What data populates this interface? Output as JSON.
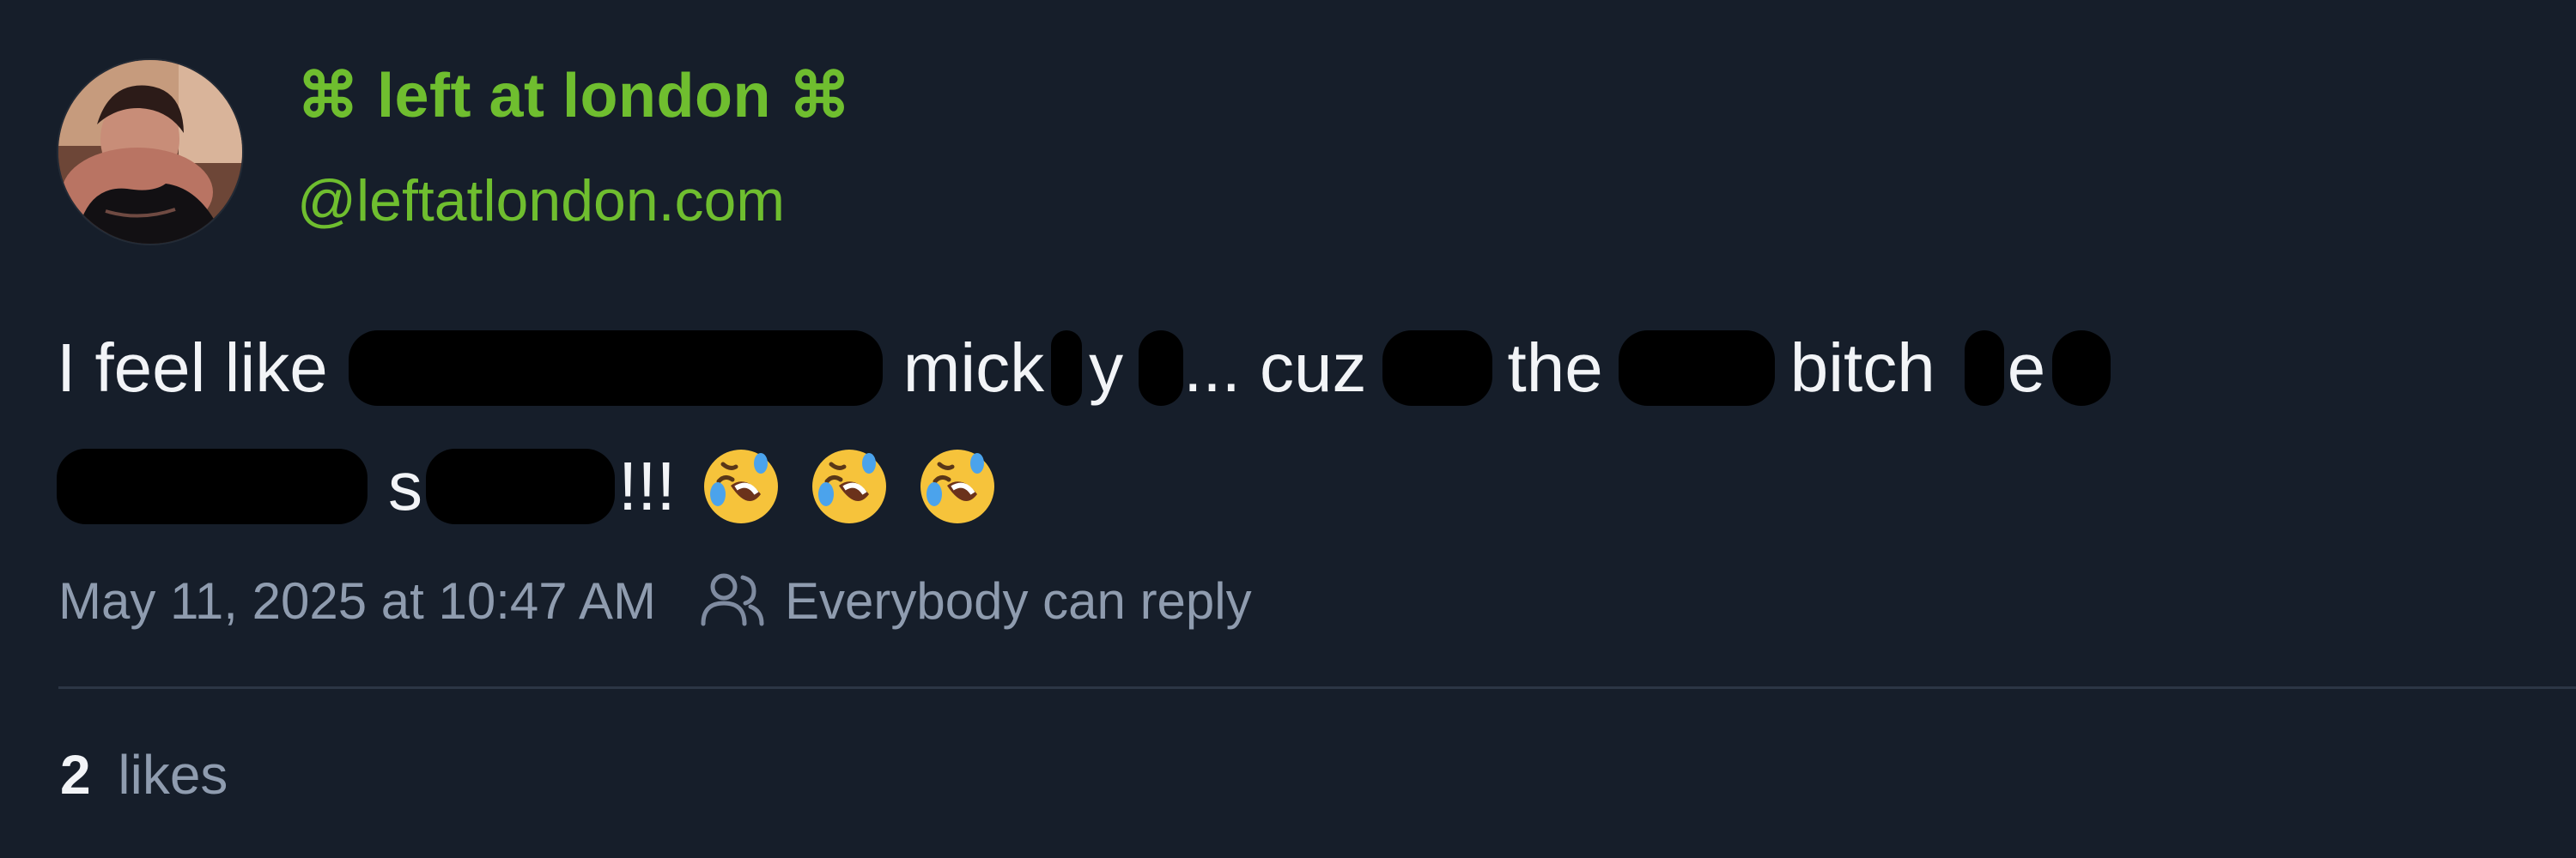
{
  "author": {
    "display_name": "⌘ left at london ⌘",
    "handle": "@leftatlondon.com",
    "accent_color": "#6fbe2f"
  },
  "post": {
    "line1": {
      "w1": "I feel like",
      "w2": "mick",
      "w3": "y",
      "w4": "... cuz",
      "w5": "the",
      "w6": "bitch",
      "w7": "e"
    },
    "line2": {
      "w1": "s",
      "w2": "!!!",
      "emoji_name": "rolling-on-floor-laughing-emoji"
    }
  },
  "meta": {
    "timestamp": "May 11, 2025 at 10:47 AM",
    "reply_setting": "Everybody can reply",
    "reply_icon": "people-icon"
  },
  "engagement": {
    "likes_count": "2",
    "likes_label": "likes"
  }
}
